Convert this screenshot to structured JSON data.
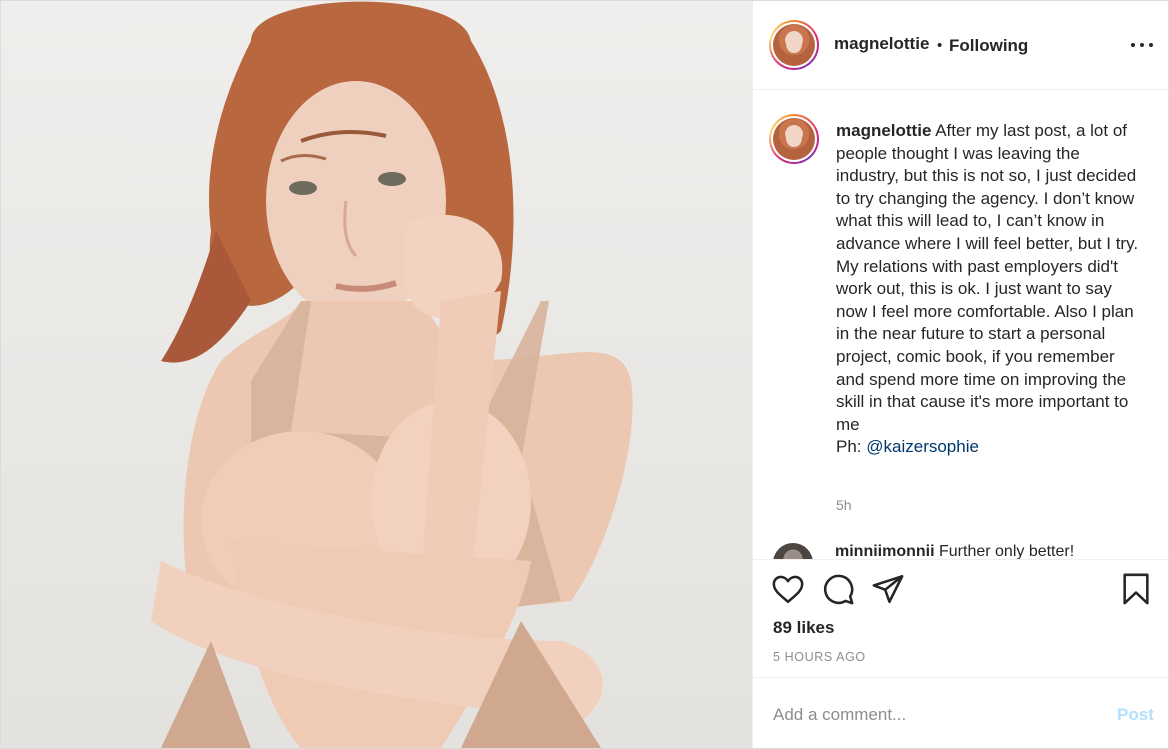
{
  "header": {
    "username": "magnelottie",
    "separator": "•",
    "follow_status": "Following",
    "more_icon": "more-horizontal-icon"
  },
  "caption": {
    "username": "magnelottie",
    "text": "After my last post, a lot of people thought I was leaving the industry, but this is not so, I just decided to try changing the agency. I don’t know what this will lead to, I can’t know in advance where I will feel better, but I try. My relations with past employers did't work out, this is ok. I just want to say now I feel more comfortable. Also I plan in the near future to start a personal project, comic book, if you remember and spend more time on improving the skill in that cause it's more important to me",
    "credit_prefix": "Ph: ",
    "mention": "@kaizersophie",
    "time": "5h"
  },
  "next_comment": {
    "username": "minniimonnii",
    "text": "Further only better!"
  },
  "actions": {
    "like_icon": "heart-icon",
    "comment_icon": "comment-bubble-icon",
    "share_icon": "paper-plane-icon",
    "save_icon": "bookmark-icon"
  },
  "likes": "89 likes",
  "posted_time": "5 HOURS AGO",
  "add_comment": {
    "placeholder": "Add a comment...",
    "post_label": "Post"
  },
  "colors": {
    "text": "#262626",
    "muted": "#8e8e8e",
    "link": "#00376b",
    "post_disabled": "#b2dffc",
    "border": "#efefef"
  }
}
